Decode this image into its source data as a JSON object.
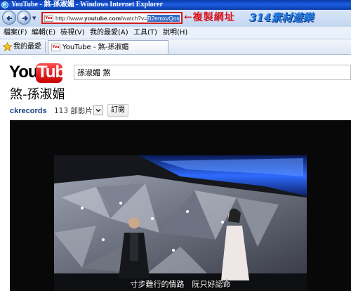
{
  "window": {
    "title": "YouTube - 煞-孫淑媚 - Windows Internet Explorer"
  },
  "address_bar": {
    "favicon_text": "You",
    "url_plain": "http://www.",
    "url_domain": "youtube.com",
    "url_path_plain": "/watch?v=",
    "url_selected": "B2emxvQos-Q"
  },
  "annotations": {
    "copy_note": "←複製網址",
    "brand_note": "314素材遊樂"
  },
  "menu": {
    "items": [
      "檔案(F)",
      "編輯(E)",
      "檢視(V)",
      "我的最愛(A)",
      "工具(T)",
      "說明(H)"
    ]
  },
  "favorites_bar": {
    "favorites_label": "我的最愛",
    "tab_label": "YouTube - 煞-孫淑媚"
  },
  "youtube": {
    "logo_you": "You",
    "logo_tube": "Tube",
    "search_value": "孫淑媚 煞",
    "video_title": "煞-孫淑媚",
    "channel": "ckrecords",
    "video_count": "113 部影片",
    "subscribe_label": "訂閱",
    "subtitle": "寸步難行的情路　阮只好認命"
  },
  "colors": {
    "title_bar": "#1c5de2",
    "url_border": "#c81e1e",
    "copy_note": "#d8141c",
    "brand_note": "#2a7fe0",
    "channel_link": "#1a3f82",
    "youtube_red": "#e00000"
  },
  "icons": [
    "ie-icon",
    "back-arrow-icon",
    "forward-arrow-icon",
    "dropdown-icon",
    "favorites-star-icon",
    "youtube-favicon-icon"
  ]
}
